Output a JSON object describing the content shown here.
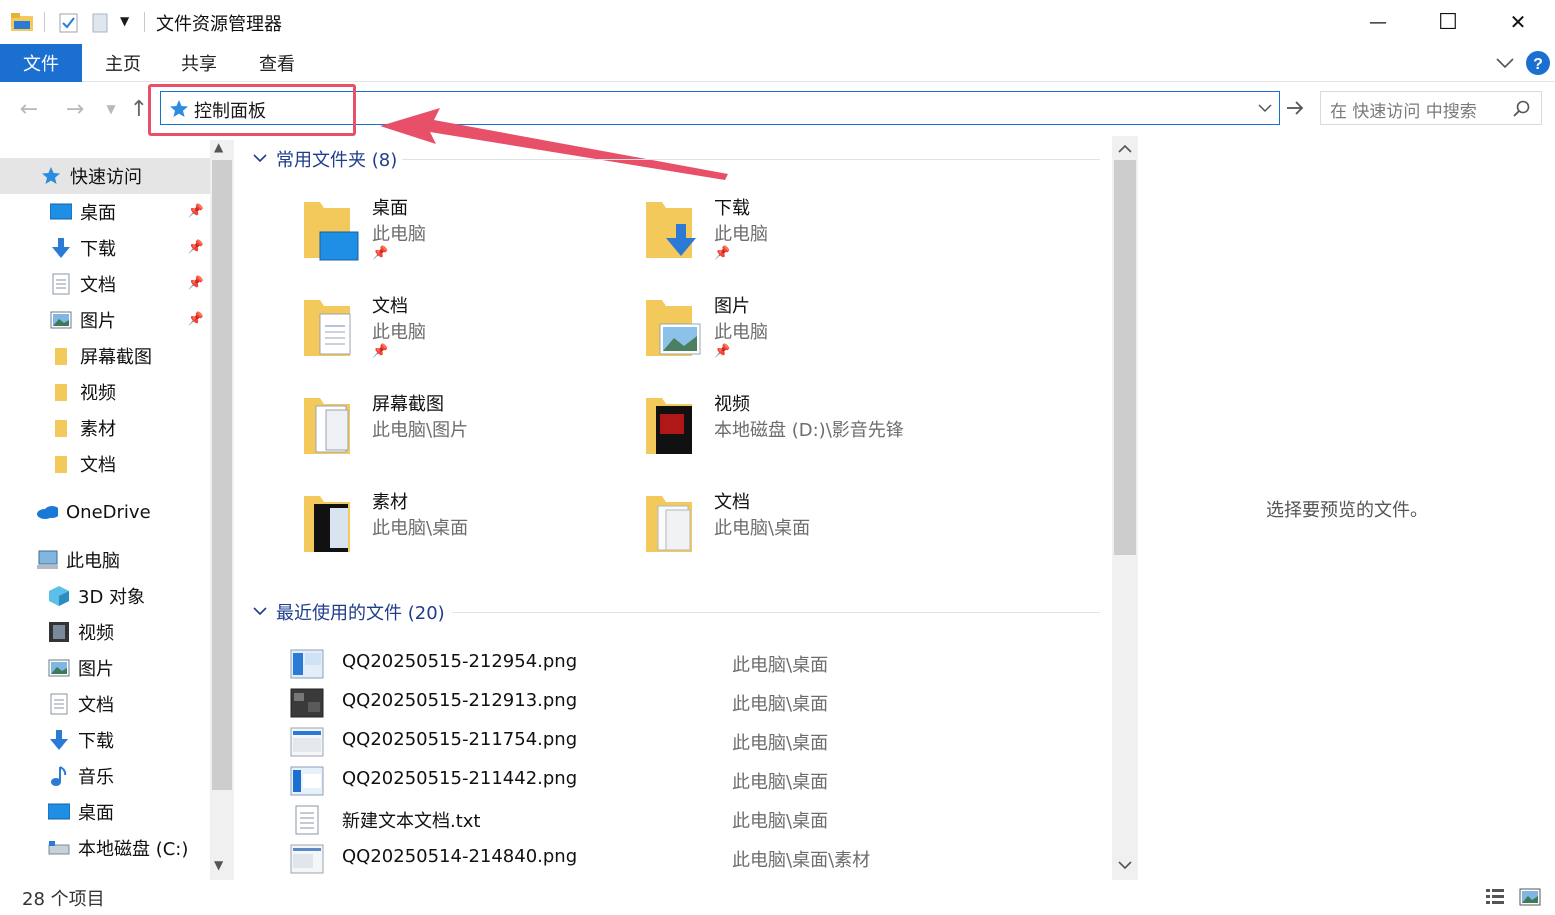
{
  "window": {
    "title": "文件资源管理器",
    "minimize": "—",
    "maximize": "☐",
    "close": "✕"
  },
  "ribbon": {
    "tabs": [
      "文件",
      "主页",
      "共享",
      "查看"
    ]
  },
  "address": {
    "path": "控制面板",
    "search_placeholder": "在 快速访问 中搜索"
  },
  "sidebar": {
    "quick_access": "快速访问",
    "pinned": [
      {
        "label": "桌面",
        "icon": "desktop-icon"
      },
      {
        "label": "下载",
        "icon": "download-icon"
      },
      {
        "label": "文档",
        "icon": "document-icon"
      },
      {
        "label": "图片",
        "icon": "picture-icon"
      }
    ],
    "folders": [
      "屏幕截图",
      "视频",
      "素材",
      "文档"
    ],
    "onedrive": "OneDrive",
    "this_pc": "此电脑",
    "pc_items": [
      {
        "label": "3D 对象",
        "icon": "3d-objects-icon"
      },
      {
        "label": "视频",
        "icon": "video-icon"
      },
      {
        "label": "图片",
        "icon": "picture-icon"
      },
      {
        "label": "文档",
        "icon": "document-icon"
      },
      {
        "label": "下载",
        "icon": "download-icon"
      },
      {
        "label": "音乐",
        "icon": "music-icon"
      },
      {
        "label": "桌面",
        "icon": "desktop-icon"
      },
      {
        "label": "本地磁盘 (C:)",
        "icon": "drive-icon"
      }
    ]
  },
  "content": {
    "frequent_header": "常用文件夹 (8)",
    "frequent": [
      {
        "name": "桌面",
        "location": "此电脑",
        "pinned": true
      },
      {
        "name": "下载",
        "location": "此电脑",
        "pinned": true
      },
      {
        "name": "文档",
        "location": "此电脑",
        "pinned": true
      },
      {
        "name": "图片",
        "location": "此电脑",
        "pinned": true
      },
      {
        "name": "屏幕截图",
        "location": "此电脑\\图片",
        "pinned": false
      },
      {
        "name": "视频",
        "location": "本地磁盘 (D:)\\影音先锋",
        "pinned": false
      },
      {
        "name": "素材",
        "location": "此电脑\\桌面",
        "pinned": false
      },
      {
        "name": "文档",
        "location": "此电脑\\桌面",
        "pinned": false
      }
    ],
    "recent_header": "最近使用的文件 (20)",
    "recent": [
      {
        "name": "QQ20250515-212954.png",
        "location": "此电脑\\桌面"
      },
      {
        "name": "QQ20250515-212913.png",
        "location": "此电脑\\桌面"
      },
      {
        "name": "QQ20250515-211754.png",
        "location": "此电脑\\桌面"
      },
      {
        "name": "QQ20250515-211442.png",
        "location": "此电脑\\桌面"
      },
      {
        "name": "新建文本文档.txt",
        "location": "此电脑\\桌面"
      },
      {
        "name": "QQ20250514-214840.png",
        "location": "此电脑\\桌面\\素材"
      }
    ]
  },
  "preview": {
    "message": "选择要预览的文件。"
  },
  "status": {
    "item_count": "28 个项目"
  },
  "colors": {
    "accent": "#1a6fd0",
    "highlight": "#e8506a",
    "folder": "#f3c95b"
  }
}
